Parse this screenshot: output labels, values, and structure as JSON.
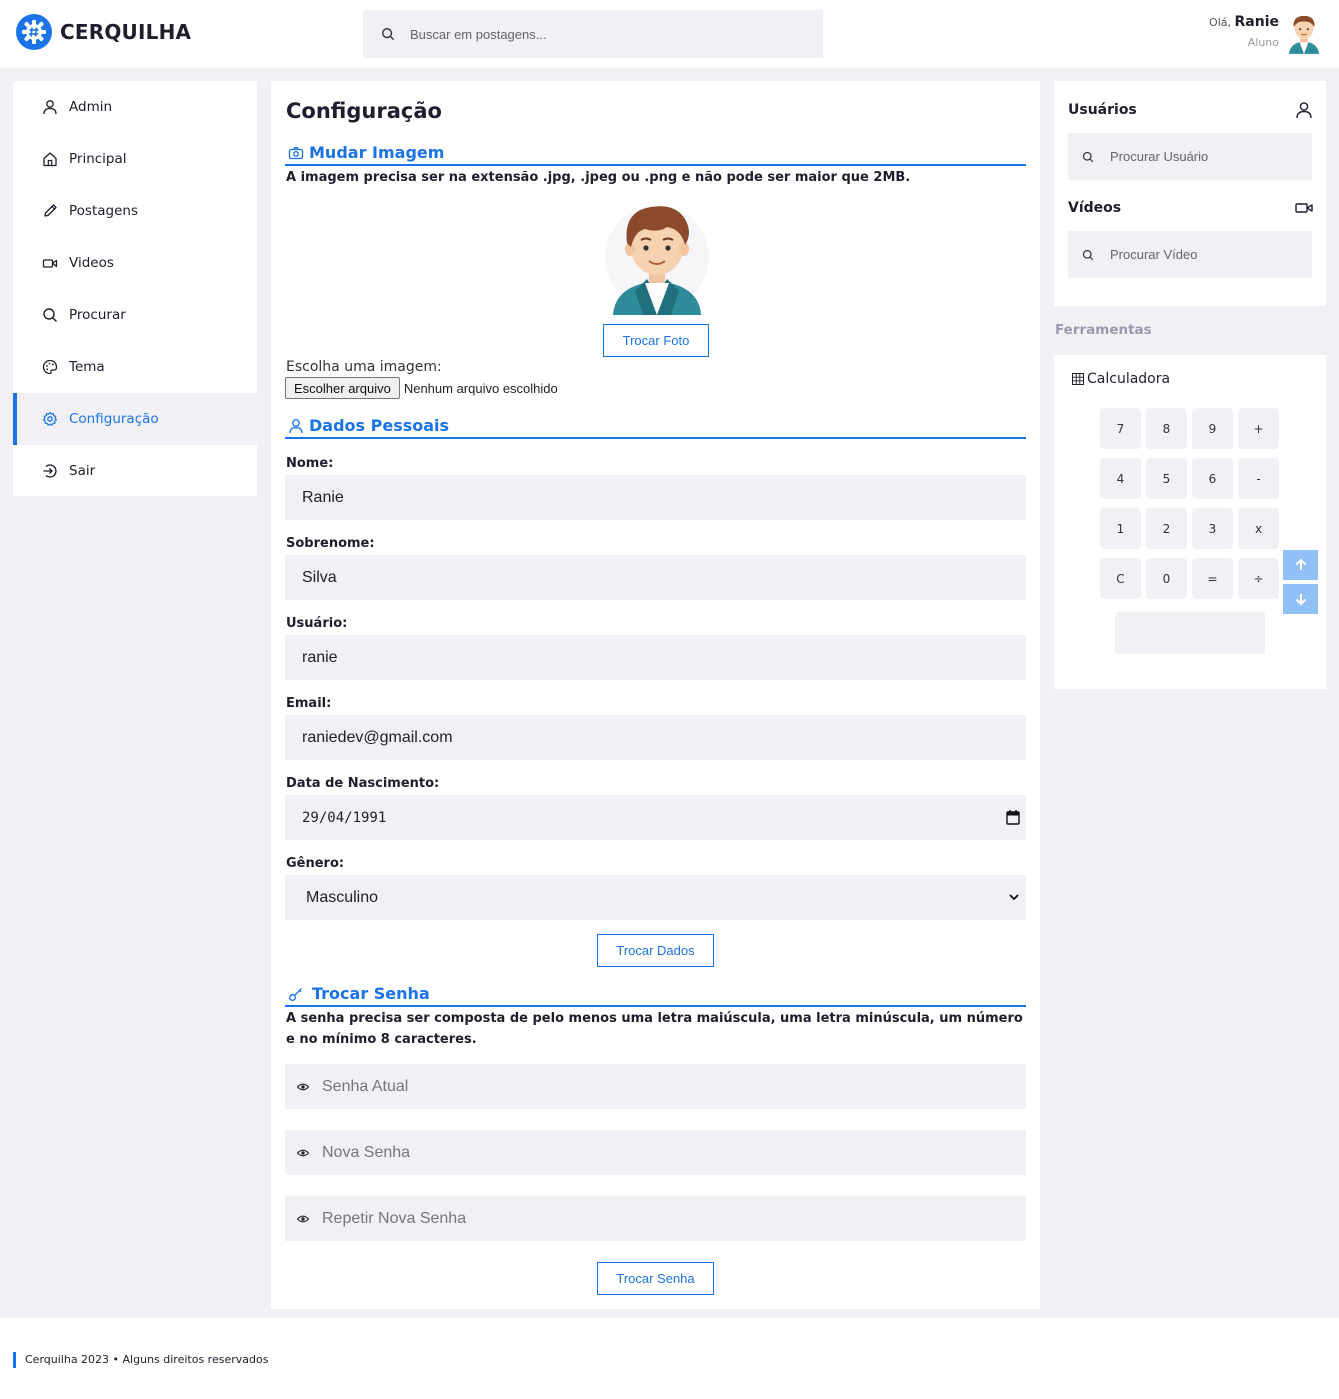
{
  "brand": {
    "name": "CERQUILHA",
    "accent": "#1b73e8"
  },
  "header": {
    "search_placeholder": "Buscar em postagens...",
    "greeting": "Olá,",
    "user_name": "Ranie",
    "user_role": "Aluno"
  },
  "sidebar": {
    "items": [
      {
        "label": "Admin",
        "icon": "user-icon"
      },
      {
        "label": "Principal",
        "icon": "home-icon"
      },
      {
        "label": "Postagens",
        "icon": "pencil-icon"
      },
      {
        "label": "Videos",
        "icon": "video-icon"
      },
      {
        "label": "Procurar",
        "icon": "search-icon"
      },
      {
        "label": "Tema",
        "icon": "palette-icon"
      },
      {
        "label": "Configuração",
        "icon": "gear-icon",
        "active": true
      },
      {
        "label": "Sair",
        "icon": "logout-icon"
      }
    ]
  },
  "main": {
    "title": "Configuração",
    "image_section": {
      "heading": "Mudar Imagem",
      "note": "A imagem precisa ser na extensão .jpg, .jpeg ou .png e não pode ser maior que 2MB.",
      "change_photo_button": "Trocar Foto",
      "file_label": "Escolha uma imagem:",
      "file_button": "Escolher arquivo",
      "file_status": "Nenhum arquivo escolhido"
    },
    "personal_section": {
      "heading": "Dados Pessoais",
      "fields": {
        "nome_label": "Nome:",
        "nome_value": "Ranie",
        "sobrenome_label": "Sobrenome:",
        "sobrenome_value": "Silva",
        "usuario_label": "Usuário:",
        "usuario_value": "ranie",
        "email_label": "Email:",
        "email_value": "raniedev@gmail.com",
        "nascimento_label": "Data de Nascimento:",
        "nascimento_value": "29/04/1991",
        "genero_label": "Gênero:",
        "genero_value": "Masculino"
      },
      "submit_button": "Trocar Dados"
    },
    "password_section": {
      "heading": "Trocar Senha",
      "note": "A senha precisa ser composta de pelo menos uma letra maiúscula, uma letra minúscula, um número e no mínimo 8 caracteres.",
      "current_placeholder": "Senha Atual",
      "new_placeholder": "Nova Senha",
      "repeat_placeholder": "Repetir Nova Senha",
      "submit_button": "Trocar Senha"
    }
  },
  "right": {
    "users_title": "Usuários",
    "users_search": "Procurar Usuário",
    "videos_title": "Vídeos",
    "videos_search": "Procurar Vídeo",
    "tools_title": "Ferramentas",
    "calculator": {
      "title": "Calculadora",
      "keys": [
        "7",
        "8",
        "9",
        "+",
        "4",
        "5",
        "6",
        "-",
        "1",
        "2",
        "3",
        "x",
        "C",
        "0",
        "=",
        "÷"
      ],
      "display": ""
    }
  },
  "footer": {
    "text": "Cerquilha 2023 • Alguns direitos reservados"
  }
}
